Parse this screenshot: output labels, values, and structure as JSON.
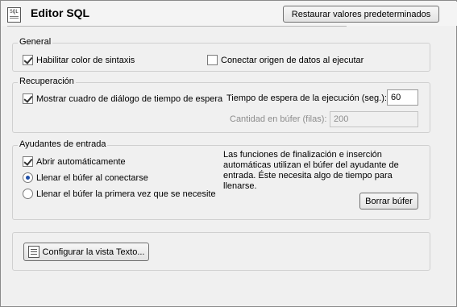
{
  "window": {
    "title": "Editor SQL",
    "icon_text": "SQL"
  },
  "header": {
    "restore_defaults_label": "Restaurar valores predeterminados"
  },
  "general": {
    "legend": "General",
    "syntax_color_label": "Habilitar color de sintaxis",
    "syntax_color_checked": true,
    "connect_source_label": "Conectar origen de datos al ejecutar",
    "connect_source_checked": false
  },
  "recovery": {
    "legend": "Recuperación",
    "show_timeout_dialog_label": "Mostrar cuadro de diálogo de tiempo de espera",
    "show_timeout_dialog_checked": true,
    "timeout_label": "Tiempo de espera de la ejecución (seg.):",
    "timeout_value": "60",
    "buffer_amount_label": "Cantidad en búfer (filas):",
    "buffer_amount_value": "200"
  },
  "entry_helpers": {
    "legend": "Ayudantes de entrada",
    "auto_open_label": "Abrir automáticamente",
    "auto_open_checked": true,
    "fill_on_connect_label": "Llenar el búfer al conectarse",
    "fill_on_connect_selected": true,
    "fill_first_needed_label": "Llenar el búfer la primera vez que se necesite",
    "fill_first_needed_selected": false,
    "description": "Las funciones de finalización e inserción automáticas utilizan el búfer del ayudante de entrada. Éste necesita algo de tiempo para llenarse.",
    "clear_buffer_label": "Borrar búfer"
  },
  "text_view": {
    "configure_label": "Configurar la vista Texto..."
  }
}
